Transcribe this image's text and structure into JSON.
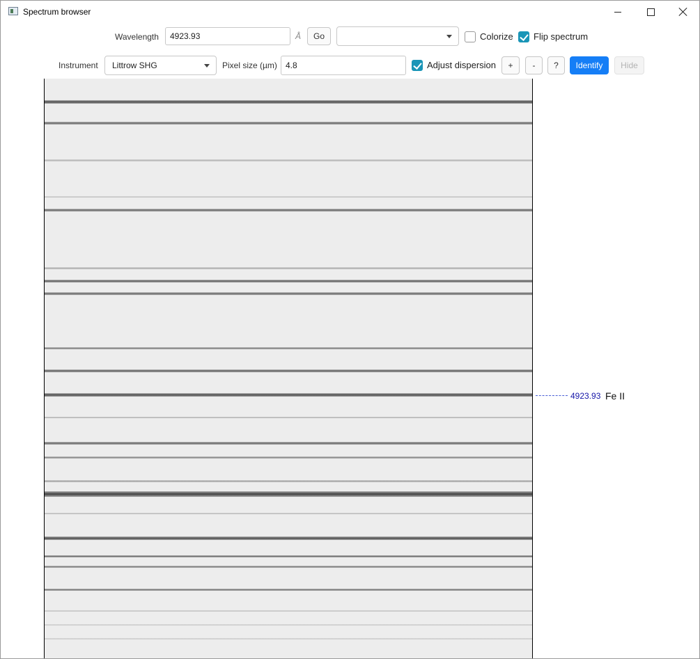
{
  "window": {
    "title": "Spectrum browser"
  },
  "toolbar1": {
    "wavelength_label": "Wavelength",
    "wavelength_value": "4923.93",
    "unit": "Å",
    "go_label": "Go",
    "dropdown_value": "",
    "colorize_label": "Colorize",
    "colorize_checked": false,
    "flip_label": "Flip spectrum",
    "flip_checked": true
  },
  "toolbar2": {
    "instrument_label": "Instrument",
    "instrument_value": "Littrow SHG",
    "pixel_size_label": "Pixel size (µm)",
    "pixel_size_value": "4.8",
    "adjust_label": "Adjust dispersion",
    "adjust_checked": true,
    "plus_label": "+",
    "minus_label": "-",
    "help_label": "?",
    "identify_label": "Identify",
    "hide_label": "Hide"
  },
  "annotation": {
    "wavelength": "4923.93",
    "element": "Fe II",
    "color": "#1515a8"
  },
  "colors": {
    "accent": "#157ef6",
    "checkbox": "#1a95b7"
  }
}
